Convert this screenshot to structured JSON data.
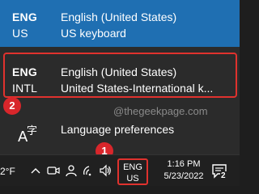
{
  "languages": [
    {
      "code": "ENG",
      "variant": "US",
      "name": "English (United States)",
      "keyboard": "US keyboard",
      "selected": true
    },
    {
      "code": "ENG",
      "variant": "INTL",
      "name": "English (United States)",
      "keyboard": "United States-International k...",
      "selected": false
    }
  ],
  "watermark": "@thegeekpage.com",
  "language_preferences": "Language preferences",
  "badges": {
    "one": "1",
    "two": "2"
  },
  "taskbar": {
    "temperature": "2°F",
    "lang_code": "ENG",
    "lang_variant": "US",
    "time": "1:16 PM",
    "date": "5/23/2022",
    "notification_count": "2"
  },
  "colors": {
    "accent": "#1f6fb2",
    "highlight": "#e0322e",
    "badge": "#d8262b"
  }
}
